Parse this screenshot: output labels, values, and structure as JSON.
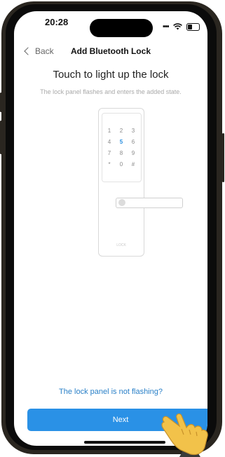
{
  "status": {
    "time": "20:28"
  },
  "nav": {
    "back_label": "Back",
    "title": "Add Bluetooth Lock"
  },
  "main": {
    "heading": "Touch to light up the lock",
    "subtext": "The lock panel flashes and enters the added state.",
    "keypad": {
      "keys": [
        "1",
        "2",
        "3",
        "4",
        "5",
        "6",
        "7",
        "8",
        "9",
        "*",
        "0",
        "#"
      ],
      "highlighted_key": "5",
      "highlight_color": "#2a8fe0"
    },
    "lock_brand": "LOCK"
  },
  "footer": {
    "help_link": "The lock panel is not flashing?",
    "next_label": "Next",
    "accent_color": "#2a91e6"
  }
}
